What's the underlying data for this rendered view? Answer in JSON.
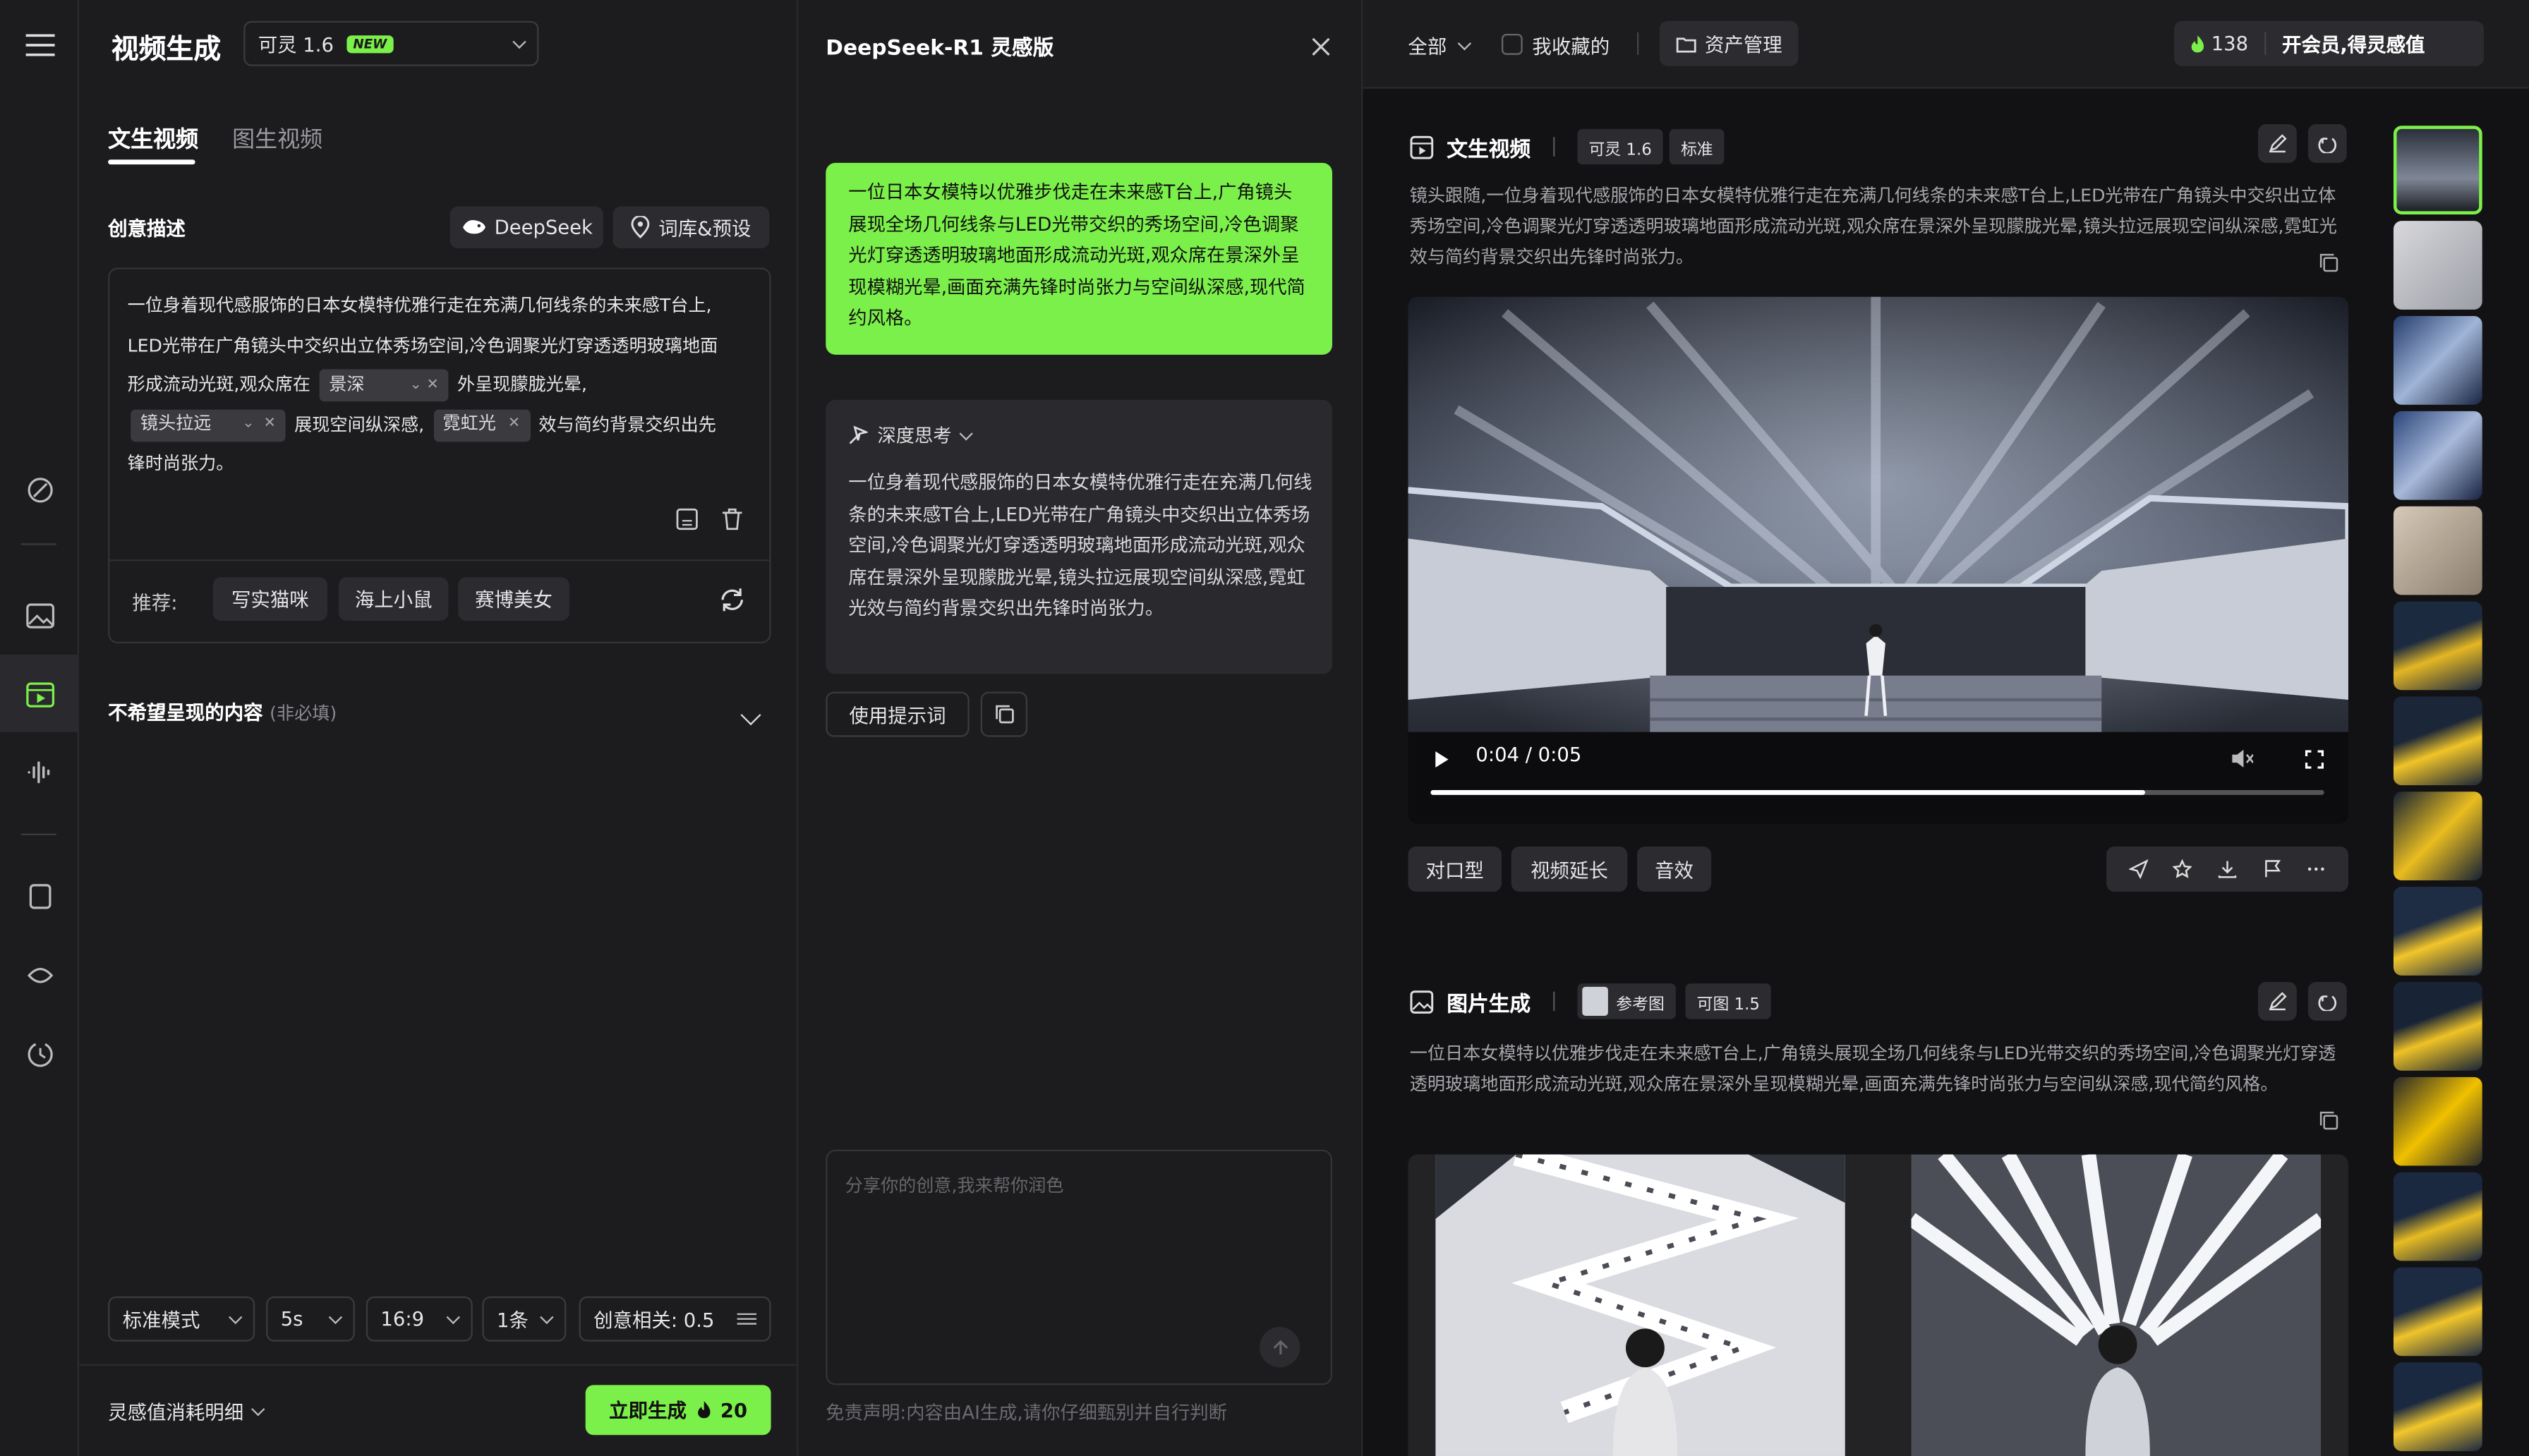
{
  "header": {
    "title": "视频生成",
    "model": "可灵 1.6",
    "model_badge": "NEW"
  },
  "tabs": [
    "文生视频",
    "图生视频"
  ],
  "creative": {
    "label": "创意描述",
    "deepseek_btn": "DeepSeek",
    "presets_btn": "词库&预设",
    "text_a": "一位身着现代感服饰的日本女模特优雅行走在充满几何线条的未来感T台上,",
    "text_b": "LED光带在广角镜头中交织出立体秀场空间,冷色调聚光灯穿透透明玻璃地面",
    "text_c": "形成流动光斑,观众席在",
    "tag1": "景深",
    "text_d": "外呈现朦胧光晕,",
    "tag2": "镜头拉远",
    "text_e": "展现空间纵深感,",
    "tag3": "霓虹光",
    "text_f": "效与简约背景交织出先",
    "text_g": "锋时尚张力。"
  },
  "recommend": {
    "label": "推荐:",
    "items": [
      "写实猫咪",
      "海上小鼠",
      "赛博美女"
    ]
  },
  "negative": {
    "label": "不希望呈现的内容",
    "optional": "(非必填)"
  },
  "settings": {
    "mode": "标准模式",
    "duration": "5s",
    "ratio": "16:9",
    "count": "1条",
    "relevance": "创意相关: 0.5"
  },
  "footer": {
    "cost_detail": "灵感值消耗明细",
    "generate": "立即生成",
    "cost": "20"
  },
  "deepseek": {
    "title": "DeepSeek-R1 灵感版",
    "result": "一位日本女模特以优雅步伐走在未来感T台上,广角镜头展现全场几何线条与LED光带交织的秀场空间,冷色调聚光灯穿透透明玻璃地面形成流动光斑,观众席在景深外呈现模糊光晕,画面充满先锋时尚张力与空间纵深感,现代简约风格。",
    "think_label": "深度思考",
    "think_text": "一位身着现代感服饰的日本女模特优雅行走在充满几何线条的未来感T台上,LED光带在广角镜头中交织出立体秀场空间,冷色调聚光灯穿透透明玻璃地面形成流动光斑,观众席在景深外呈现朦胧光晕,镜头拉远展现空间纵深感,霓虹光效与简约背景交织出先锋时尚张力。",
    "use_prompt": "使用提示词",
    "input_placeholder": "分享你的创意,我来帮你润色",
    "disclaimer": "免责声明:内容由AI生成,请你仔细甄别并自行判断"
  },
  "topbar": {
    "filter": "全部",
    "fav": "我收藏的",
    "assets": "资产管理",
    "points": "138",
    "vip": "开会员,得灵感值"
  },
  "card1": {
    "title": "文生视频",
    "model": "可灵 1.6",
    "quality": "标准",
    "desc": "镜头跟随,一位身着现代感服饰的日本女模特优雅行走在充满几何线条的未来感T台上,LED光带在广角镜头中交织出立体秀场空间,冷色调聚光灯穿透透明玻璃地面形成流动光斑,观众席在景深外呈现朦胧光晕,镜头拉远展现空间纵深感,霓虹光效与简约背景交织出先锋时尚张力。",
    "time": "0:04 / 0:05",
    "progress": 0.8,
    "actions": [
      "对口型",
      "视频延长",
      "音效"
    ]
  },
  "card2": {
    "title": "图片生成",
    "ref": "参考图",
    "model": "可图 1.5",
    "desc": "一位日本女模特以优雅步伐走在未来感T台上,广角镜头展现全场几何线条与LED光带交织的秀场空间,冷色调聚光灯穿透透明玻璃地面形成流动光斑,观众席在景深外呈现模糊光晕,画面充满先锋时尚张力与空间纵深感,现代简约风格。"
  },
  "colors": {
    "accent": "#7cf04a",
    "bg": "#1c1c1f",
    "panel": "#121214"
  }
}
